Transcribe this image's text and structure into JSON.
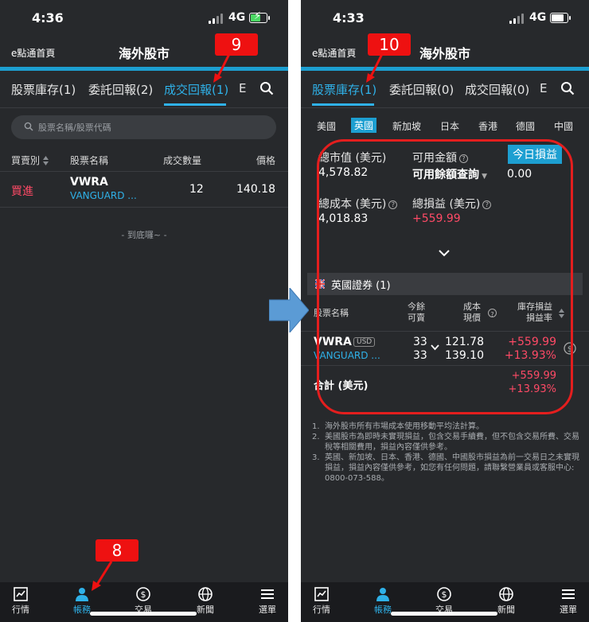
{
  "left": {
    "status": {
      "time": "4:36",
      "network": "4G"
    },
    "nav": {
      "home": "e點通首頁",
      "title": "海外股市"
    },
    "tabs": [
      "股票庫存(1)",
      "委託回報(2)",
      "成交回報(1)",
      "E"
    ],
    "search": {
      "placeholder": "股票名稱/股票代碼"
    },
    "table": {
      "headers": [
        "買賣別",
        "股票名稱",
        "成交數量",
        "價格"
      ],
      "row": {
        "side": "買進",
        "symbol": "VWRA",
        "name": "VANGUARD ...",
        "qty": "12",
        "price": "140.18"
      }
    },
    "end_text": "- 到底囉~ -",
    "badges": {
      "top": "9",
      "bottom": "8"
    }
  },
  "right": {
    "status": {
      "time": "4:33",
      "network": "4G"
    },
    "nav": {
      "home": "e點通首頁",
      "title": "海外股市"
    },
    "tabs": [
      "股票庫存(1)",
      "委託回報(0)",
      "成交回報(0)",
      "E"
    ],
    "markets": [
      "美國",
      "英國",
      "新加坡",
      "日本",
      "香港",
      "德國",
      "中國"
    ],
    "summary": {
      "market_value_label": "總市值 (美元)",
      "market_value": "4,578.82",
      "available_label": "可用金額",
      "available_query": "可用餘額查詢",
      "today_pl_label": "今日損益",
      "today_pl": "0.00",
      "cost_label": "總成本 (美元)",
      "cost": "4,018.83",
      "pl_label": "總損益 (美元)",
      "pl": "+559.99"
    },
    "section_title": "英國證券 (1)",
    "table_headers": {
      "name": "股票名稱",
      "remain": "今餘\n可賣",
      "cost": "成本\n現價",
      "pl": "庫存損益\n損益率"
    },
    "holding": {
      "symbol": "VWRA",
      "currency": "USD",
      "name": "VANGUARD ...",
      "remain1": "33",
      "remain2": "33",
      "cost": "121.78",
      "price": "139.10",
      "pl": "+559.99",
      "pl_rate": "+13.93%"
    },
    "total": {
      "label": "合計 (美元)",
      "pl": "+559.99",
      "pl_rate": "+13.93%"
    },
    "notes": [
      "海外股市所有市場成本使用移動平均法計算。",
      "美國股市為即時未實現損益，包含交易手續費，但不包含交易所費、交易稅等相關費用，損益內容僅供參考。",
      "英國、新加坡、日本、香港、德國、中國股市損益為前一交易日之未實現損益，損益內容僅供參考，如您有任何問題，請聯繫營業員或客服中心: 0800-073-588。"
    ],
    "badge": "10"
  },
  "bottom_nav": [
    "行情",
    "帳務",
    "交易",
    "新聞",
    "選單"
  ],
  "colors": {
    "accent": "#1d9fd1",
    "loss_red": "#ff4a66",
    "annotation_red": "#ee1111"
  }
}
